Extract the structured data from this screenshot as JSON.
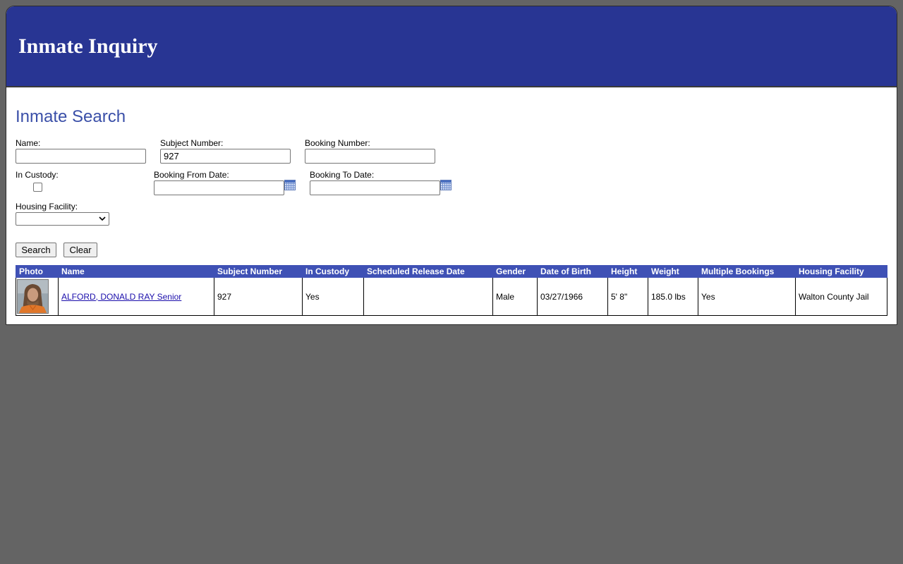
{
  "header": {
    "title": "Inmate Inquiry"
  },
  "search": {
    "title": "Inmate Search",
    "name_label": "Name:",
    "name_value": "",
    "subject_number_label": "Subject Number:",
    "subject_number_value": "927",
    "booking_number_label": "Booking Number:",
    "booking_number_value": "",
    "in_custody_label": "In Custody:",
    "booking_from_label": "Booking From Date:",
    "booking_from_value": "",
    "booking_to_label": "Booking To Date:",
    "booking_to_value": "",
    "housing_facility_label": "Housing Facility:",
    "housing_facility_value": "",
    "search_button": "Search",
    "clear_button": "Clear",
    "calendar_icon": "calendar-icon"
  },
  "results": {
    "columns": [
      "Photo",
      "Name",
      "Subject Number",
      "In Custody",
      "Scheduled Release Date",
      "Gender",
      "Date of Birth",
      "Height",
      "Weight",
      "Multiple Bookings",
      "Housing Facility"
    ],
    "rows": [
      {
        "name": "ALFORD, DONALD RAY Senior",
        "subject_number": "927",
        "in_custody": "Yes",
        "scheduled_release_date": "",
        "gender": "Male",
        "date_of_birth": "03/27/1966",
        "height": "5' 8\"",
        "weight": "185.0 lbs",
        "multiple_bookings": "Yes",
        "housing_facility": "Walton County Jail"
      }
    ]
  },
  "colors": {
    "header_bg": "#283593",
    "table_header_bg": "#3f51b5",
    "section_title": "#3a4fa8",
    "page_bg": "#646464"
  }
}
